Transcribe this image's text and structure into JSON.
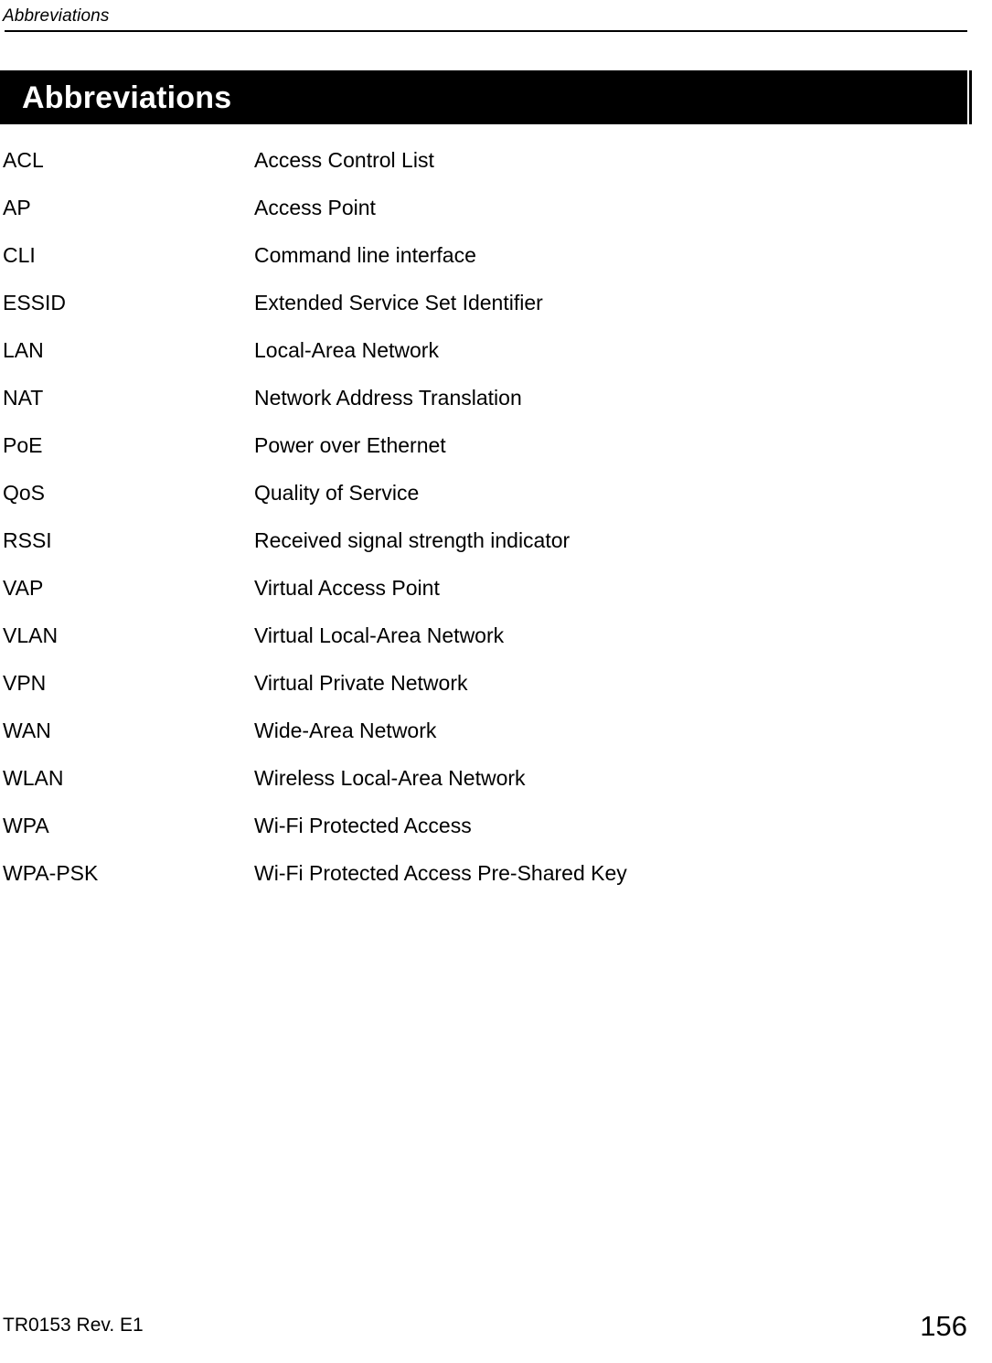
{
  "header": {
    "running_title": "Abbreviations"
  },
  "chapter": {
    "banner_title": "Abbreviations"
  },
  "abbreviations": [
    {
      "term": "ACL",
      "definition": "Access Control List"
    },
    {
      "term": "AP",
      "definition": "Access Point"
    },
    {
      "term": "CLI",
      "definition": "Command line interface"
    },
    {
      "term": "ESSID",
      "definition": "Extended Service Set Identifier"
    },
    {
      "term": "LAN",
      "definition": "Local-Area Network"
    },
    {
      "term": "NAT",
      "definition": "Network Address Translation"
    },
    {
      "term": "PoE",
      "definition": "Power over Ethernet"
    },
    {
      "term": "QoS",
      "definition": "Quality of Service"
    },
    {
      "term": "RSSI",
      "definition": "Received signal strength indicator"
    },
    {
      "term": "VAP",
      "definition": "Virtual Access Point"
    },
    {
      "term": "VLAN",
      "definition": "Virtual Local-Area Network"
    },
    {
      "term": "VPN",
      "definition": "Virtual Private Network"
    },
    {
      "term": "WAN",
      "definition": "Wide-Area Network"
    },
    {
      "term": "WLAN",
      "definition": "Wireless Local-Area Network"
    },
    {
      "term": "WPA",
      "definition": "Wi-Fi Protected Access"
    },
    {
      "term": "WPA-PSK",
      "definition": "Wi-Fi Protected Access Pre-Shared Key"
    }
  ],
  "footer": {
    "document_reference": "TR0153 Rev. E1",
    "page_number": "156"
  },
  "colors": {
    "page_background": "#ffffff",
    "text": "#000000",
    "banner_background": "#000000",
    "banner_text": "#ffffff"
  }
}
